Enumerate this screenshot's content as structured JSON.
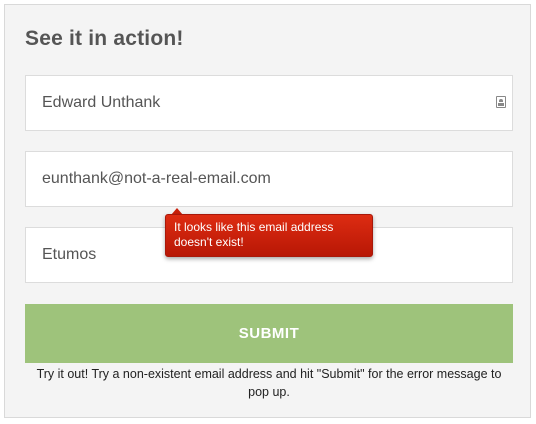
{
  "section": {
    "title": "See it in action!"
  },
  "form": {
    "name_value": "Edward Unthank",
    "email_value": "eunthank@not-a-real-email.com",
    "company_value": "Etumos",
    "submit_label": "SUBMIT"
  },
  "tooltip": {
    "message": "It looks like this email address doesn't exist!"
  },
  "help": {
    "text": "Try it out! Try a non-existent email address and hit \"Submit\" for the error message to pop up."
  },
  "icons": {
    "name_field": "contact-card-icon"
  },
  "colors": {
    "submit_bg": "#9ec37b",
    "error_bg": "#c9200b",
    "panel_bg": "#f4f4f4"
  }
}
